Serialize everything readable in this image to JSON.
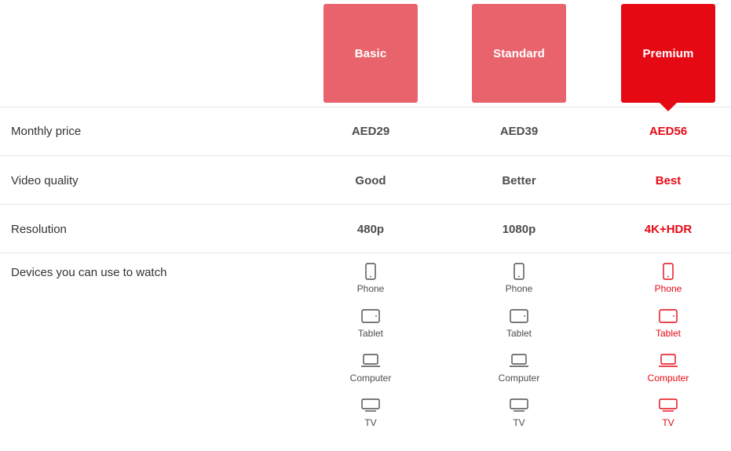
{
  "colors": {
    "plan_default": "#e8636c",
    "plan_highlight": "#e50914",
    "accent_text": "#e50914",
    "value_text": "#4d4d4d",
    "label_text": "#333333",
    "divider": "#e6e6e6",
    "background": "#ffffff"
  },
  "plans": [
    {
      "name": "Basic",
      "highlighted": false
    },
    {
      "name": "Standard",
      "highlighted": false
    },
    {
      "name": "Premium",
      "highlighted": true
    }
  ],
  "rows": [
    {
      "label": "Monthly price",
      "values": [
        "AED29",
        "AED39",
        "AED56"
      ]
    },
    {
      "label": "Video quality",
      "values": [
        "Good",
        "Better",
        "Best"
      ]
    },
    {
      "label": "Resolution",
      "values": [
        "480p",
        "1080p",
        "4K+HDR"
      ]
    }
  ],
  "devices_row": {
    "label": "Devices you can use to watch",
    "devices": [
      "Phone",
      "Tablet",
      "Computer",
      "TV"
    ],
    "icons": [
      "phone-icon",
      "tablet-icon",
      "computer-icon",
      "tv-icon"
    ],
    "columns": [
      {
        "plan": "Basic",
        "devices": [
          "Phone",
          "Tablet",
          "Computer",
          "TV"
        ],
        "highlighted": false
      },
      {
        "plan": "Standard",
        "devices": [
          "Phone",
          "Tablet",
          "Computer",
          "TV"
        ],
        "highlighted": false
      },
      {
        "plan": "Premium",
        "devices": [
          "Phone",
          "Tablet",
          "Computer",
          "TV"
        ],
        "highlighted": true
      }
    ]
  }
}
